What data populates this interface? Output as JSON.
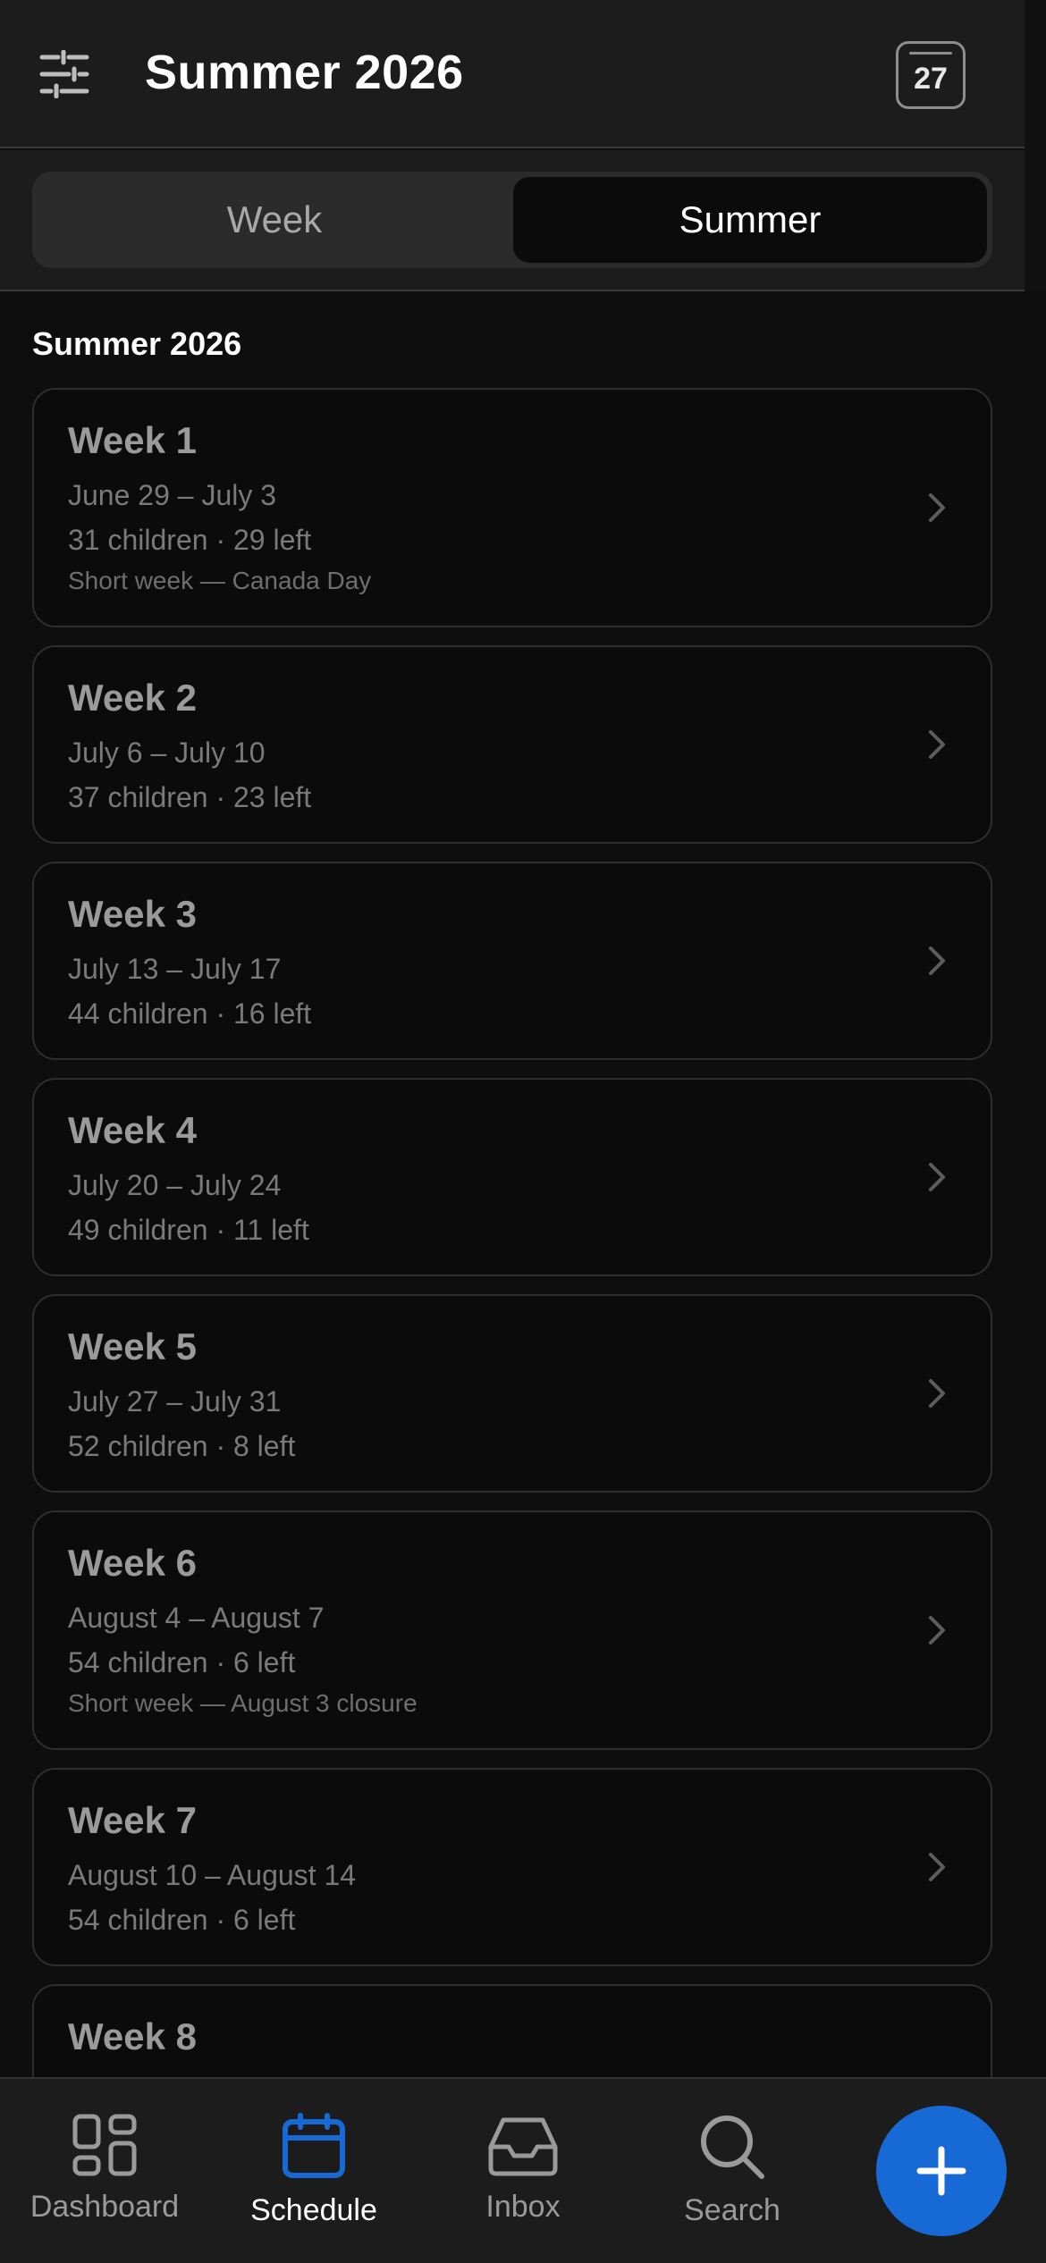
{
  "header": {
    "title": "Summer 2026",
    "calendar_day": "27",
    "filter_icon": "sliders-icon",
    "calendar_icon": "calendar-icon"
  },
  "segmented": {
    "options": [
      "Week",
      "Summer"
    ],
    "selected": "Summer"
  },
  "section_title": "Summer 2026",
  "weeks": [
    {
      "label": "Week 1",
      "dates": "June 29 – July 3",
      "counts": "31 children · 29 left",
      "note": "Short week — Canada Day"
    },
    {
      "label": "Week 2",
      "dates": "July 6 – July 10",
      "counts": "37 children · 23 left",
      "note": ""
    },
    {
      "label": "Week 3",
      "dates": "July 13 – July 17",
      "counts": "44 children · 16 left",
      "note": ""
    },
    {
      "label": "Week 4",
      "dates": "July 20 – July 24",
      "counts": "49 children · 11 left",
      "note": ""
    },
    {
      "label": "Week 5",
      "dates": "July 27 – July 31",
      "counts": "52 children · 8 left",
      "note": ""
    },
    {
      "label": "Week 6",
      "dates": "August 4 – August 7",
      "counts": "54 children · 6 left",
      "note": "Short week — August 3 closure"
    },
    {
      "label": "Week 7",
      "dates": "August 10 – August 14",
      "counts": "54 children · 6 left",
      "note": ""
    },
    {
      "label": "Week 8",
      "dates": "",
      "counts": "",
      "note": ""
    }
  ],
  "tabbar": {
    "items": [
      {
        "label": "Dashboard",
        "icon": "grid-icon"
      },
      {
        "label": "Schedule",
        "icon": "calendar-icon"
      },
      {
        "label": "Inbox",
        "icon": "inbox-icon"
      },
      {
        "label": "Search",
        "icon": "search-icon"
      }
    ],
    "active": "Schedule",
    "fab_icon": "plus-icon"
  },
  "colors": {
    "accent": "#1769d6",
    "background": "#0e0e0e",
    "header": "#1c1c1c"
  }
}
